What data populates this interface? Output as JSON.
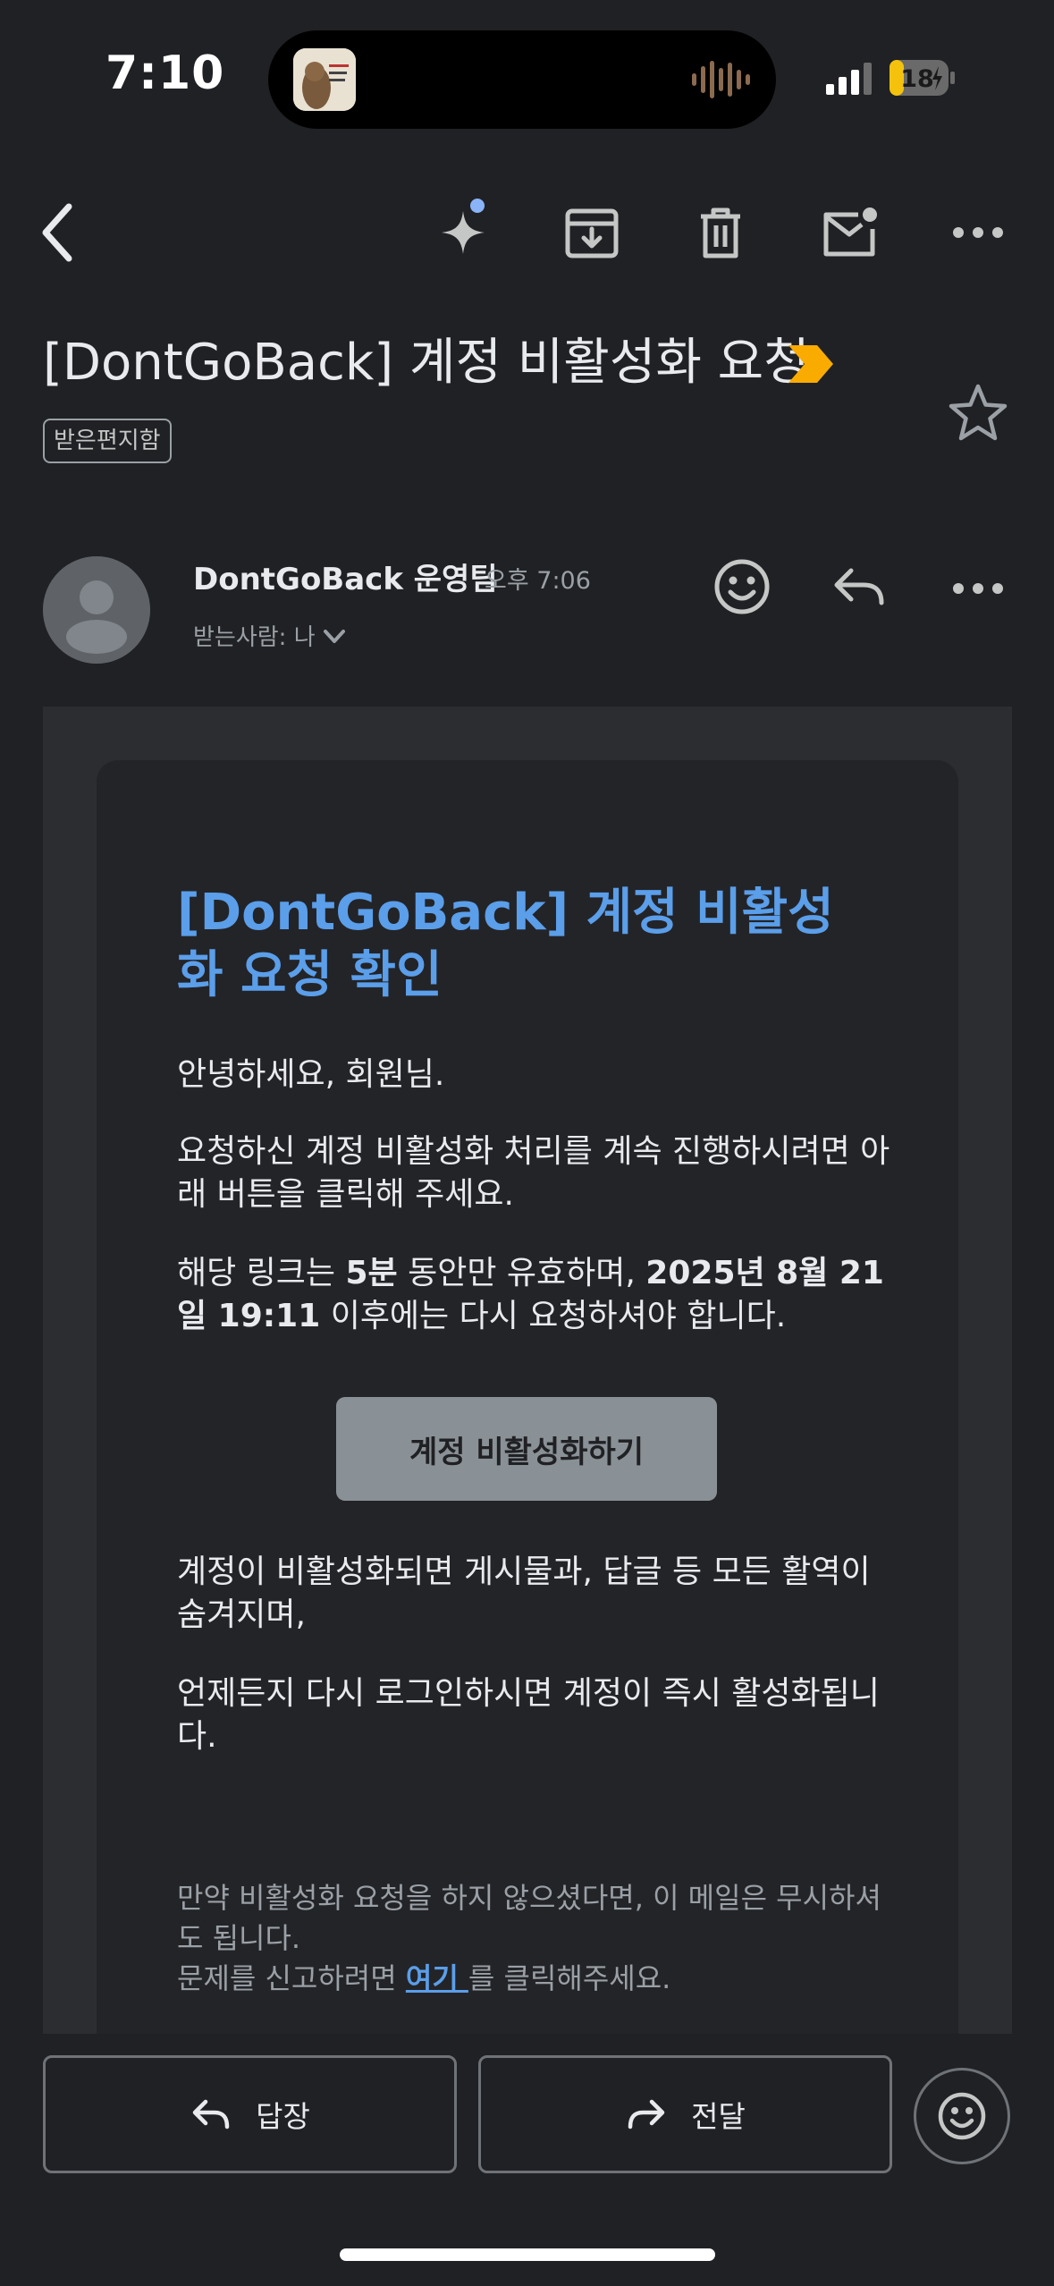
{
  "status_bar": {
    "time": "7:10",
    "battery": "18"
  },
  "toolbar": {
    "icons": [
      "back-arrow-icon",
      "gemini-sparkle-icon",
      "archive-icon",
      "trash-icon",
      "mark-unread-icon",
      "more-horizontal-icon"
    ]
  },
  "email": {
    "subject": "[DontGoBack] 계정 비활성화 요청",
    "label": "받은편지함",
    "sender": "DontGoBack 운영팀",
    "time": "오후 7:06",
    "recipient": "받는사람: 나"
  },
  "body": {
    "heading": "[DontGoBack] 계정 비활성화 요청 확인",
    "greeting": "안녕하세요, 회원님.",
    "instruction": "요청하신 계정 비활성화 처리를 계속 진행하시려면 아래 버튼을 클릭해 주세요.",
    "validity_prefix": "해당 링크는 ",
    "validity_duration": "5분",
    "validity_middle": " 동안만 유효하며, ",
    "validity_deadline": "2025년 8월 21일 19:11",
    "validity_suffix": " 이후에는 다시 요청하셔야 합니다.",
    "button_label": "계정 비활성화하기",
    "effect_note": "계정이 비활성화되면 게시물과, 답글 등 모든 활역이 숨겨지며,",
    "relogin_note": "언제든지 다시 로그인하시면 계정이 즉시 활성화됩니다.",
    "disclaimer": "만약 비활성화 요청을 하지 않으셨다면, 이 메일은 무시하셔도 됩니다.",
    "report_prefix": "문제를 신고하려면 ",
    "report_link": "여기 ",
    "report_suffix": "를 클릭해주세요."
  },
  "actions": {
    "reply_label": "답장",
    "forward_label": "전달"
  },
  "colors": {
    "background": "#202124",
    "heading_link": "#5b9ee9",
    "importance_marker": "#f9ab00",
    "button": "#8a9196"
  }
}
